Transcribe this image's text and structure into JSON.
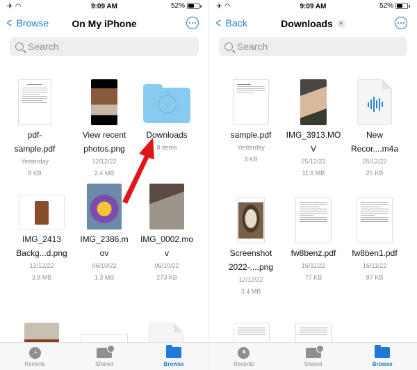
{
  "status_bar": {
    "time": "9:09 AM",
    "battery": "52%",
    "battery_level": 0.52
  },
  "left": {
    "nav": {
      "back_label": "Browse",
      "title": "On My iPhone"
    },
    "search": {
      "placeholder": "Search"
    },
    "items": [
      {
        "name1": "pdf-",
        "name2": "sample.pdf",
        "date": "Yesterday",
        "size": "8 KB",
        "kind": "pdf"
      },
      {
        "name1": "View recent",
        "name2": "photos.png",
        "date": "12/12/22",
        "size": "2.4 MB",
        "kind": "photo"
      },
      {
        "name1": "Downloads",
        "name2": "",
        "date": "8 items",
        "size": "",
        "kind": "folder"
      },
      {
        "name1": "IMG_2413",
        "name2": "Backg...d.png",
        "date": "12/12/22",
        "size": "3.8 MB",
        "kind": "photo"
      },
      {
        "name1": "IMG_2386.m",
        "name2": "ov",
        "date": "06/10/22",
        "size": "1.3 MB",
        "kind": "video"
      },
      {
        "name1": "IMG_0002.mo",
        "name2": "v",
        "date": "06/10/22",
        "size": "273 KB",
        "kind": "video"
      }
    ]
  },
  "right": {
    "nav": {
      "back_label": "Back",
      "title": "Downloads"
    },
    "search": {
      "placeholder": "Search"
    },
    "items": [
      {
        "name1": "sample.pdf",
        "name2": "",
        "date": "Yesterday",
        "size": "3 KB",
        "kind": "pdf"
      },
      {
        "name1": "IMG_3913.MO",
        "name2": "V",
        "date": "25/12/22",
        "size": "11.8 MB",
        "kind": "video"
      },
      {
        "name1": "New",
        "name2": "Recor....m4a",
        "date": "25/12/22",
        "size": "25 KB",
        "kind": "audio"
      },
      {
        "name1": "Screenshot",
        "name2": "2022-....png",
        "date": "12/12/22",
        "size": "3.4 MB",
        "kind": "image"
      },
      {
        "name1": "fw8benz.pdf",
        "name2": "",
        "date": "16/11/22",
        "size": "77 KB",
        "kind": "pdf"
      },
      {
        "name1": "fw8ben1.pdf",
        "name2": "",
        "date": "16/11/22",
        "size": "87 KB",
        "kind": "pdf"
      }
    ]
  },
  "tabs": [
    {
      "label": "Recents",
      "icon": "clock-icon"
    },
    {
      "label": "Shared",
      "icon": "shared-folder-icon"
    },
    {
      "label": "Browse",
      "icon": "folder-icon",
      "active": true
    }
  ],
  "colors": {
    "accent": "#1e7ad6",
    "folder": "#88cbf0",
    "annotation_arrow": "#e0161b"
  }
}
